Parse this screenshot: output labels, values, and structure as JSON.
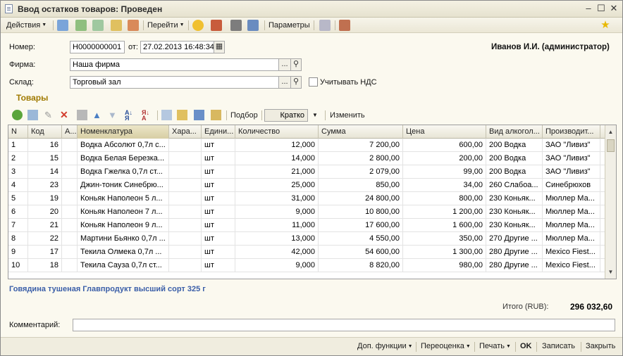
{
  "window": {
    "title": "Ввод остатков товаров: Проведен"
  },
  "toolbar": {
    "actions_label": "Действия",
    "goto_label": "Перейти",
    "params_label": "Параметры"
  },
  "form": {
    "number_label": "Номер:",
    "number_value": "Н0000000001",
    "from_label": "от:",
    "date_value": "27.02.2013 16:48:34",
    "user": "Иванов И.И. (администратор)",
    "firm_label": "Фирма:",
    "firm_value": "Наша фирма",
    "warehouse_label": "Склад:",
    "warehouse_value": "Торговый зал",
    "vat_label": "Учитывать НДС",
    "ellipsis": "...",
    "section_title": "Товары"
  },
  "table_toolbar": {
    "select_label": "Подбор",
    "view_value": "Кратко",
    "change_label": "Изменить"
  },
  "grid": {
    "columns": [
      "N",
      "Код",
      "А...",
      "Номенклатура",
      "Хара...",
      "Едини...",
      "Количество",
      "Сумма",
      "Цена",
      "Вид алкогол...",
      "Производит..."
    ],
    "rows": [
      [
        "1",
        "16",
        "",
        "Водка Абсолют 0,7л с...",
        "",
        "шт",
        "12,000",
        "7 200,00",
        "600,00",
        "200 Водка",
        "ЗАО \"Ливиз\""
      ],
      [
        "2",
        "15",
        "",
        "Водка Белая Березка...",
        "",
        "шт",
        "14,000",
        "2 800,00",
        "200,00",
        "200 Водка",
        "ЗАО \"Ливиз\""
      ],
      [
        "3",
        "14",
        "",
        "Водка Гжелка 0,7л ст...",
        "",
        "шт",
        "21,000",
        "2 079,00",
        "99,00",
        "200 Водка",
        "ЗАО \"Ливиз\""
      ],
      [
        "4",
        "23",
        "",
        "Джин-тоник Синебрю...",
        "",
        "шт",
        "25,000",
        "850,00",
        "34,00",
        "260 Слабоа...",
        "Синебрюхов"
      ],
      [
        "5",
        "19",
        "",
        "Коньяк Наполеон 5 л...",
        "",
        "шт",
        "31,000",
        "24 800,00",
        "800,00",
        "230 Коньяк...",
        "Мюллер Ма..."
      ],
      [
        "6",
        "20",
        "",
        "Коньяк Наполеон 7 л...",
        "",
        "шт",
        "9,000",
        "10 800,00",
        "1 200,00",
        "230 Коньяк...",
        "Мюллер Ма..."
      ],
      [
        "7",
        "21",
        "",
        "Коньяк Наполеон 9 л...",
        "",
        "шт",
        "11,000",
        "17 600,00",
        "1 600,00",
        "230 Коньяк...",
        "Мюллер Ма..."
      ],
      [
        "8",
        "22",
        "",
        "Мартини Бьянко 0,7л ...",
        "",
        "шт",
        "13,000",
        "4 550,00",
        "350,00",
        "270 Другие ...",
        "Мюллер Ма..."
      ],
      [
        "9",
        "17",
        "",
        "Текила Олмека 0,7л ...",
        "",
        "шт",
        "42,000",
        "54 600,00",
        "1 300,00",
        "280 Другие ...",
        "Mexico Fiest..."
      ],
      [
        "10",
        "18",
        "",
        "Текила Сауза 0,7л ст...",
        "",
        "шт",
        "9,000",
        "8 820,00",
        "980,00",
        "280 Другие ...",
        "Mexico Fiest..."
      ]
    ]
  },
  "status": {
    "selected_item": "Говядина тушеная Главпродукт высший сорт 325 г",
    "total_label": "Итого (RUB):",
    "total_value": "296 032,60",
    "comment_label": "Комментарий:"
  },
  "bottom": {
    "extra_label": "Доп. функции",
    "revalue_label": "Переоценка",
    "print_label": "Печать",
    "ok_label": "OK",
    "save_label": "Записать",
    "close_label": "Закрыть"
  }
}
